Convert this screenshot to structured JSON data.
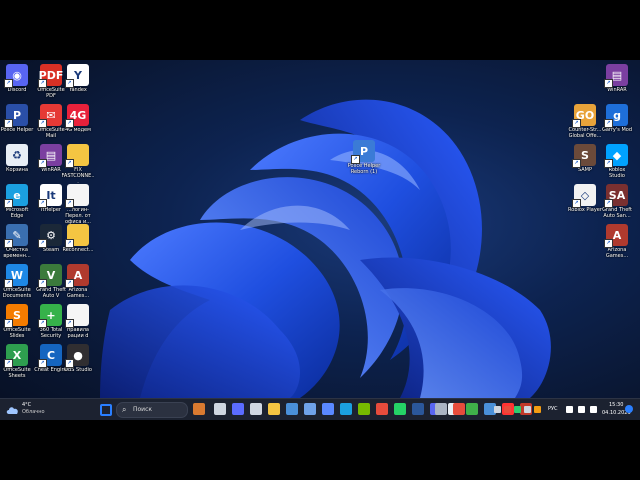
{
  "desktop": {
    "icons": [
      {
        "label": "Discord",
        "icon": "discord-icon",
        "color": "#5865f2",
        "glyph": "◉"
      },
      {
        "label": "OfficeSuite PDF",
        "icon": "pdf-icon",
        "color": "#d93025",
        "glyph": "PDF"
      },
      {
        "label": "Yandex",
        "icon": "yandex-icon",
        "color": "#ffffff",
        "glyph": "Y"
      },
      {
        "label": "Police Helper",
        "icon": "police-helper-icon",
        "color": "#2a4fa8",
        "glyph": "P"
      },
      {
        "label": "OfficeSuite Mail",
        "icon": "mail-icon",
        "color": "#e53935",
        "glyph": "✉"
      },
      {
        "label": "4G модем",
        "icon": "modem-icon",
        "color": "#e8213b",
        "glyph": "4G"
      },
      {
        "label": "Корзина",
        "icon": "recycle-bin-icon",
        "color": "#e8eef5",
        "glyph": "♻"
      },
      {
        "label": "WinRAR",
        "icon": "winrar-icon",
        "color": "#7b3fa0",
        "glyph": "▤"
      },
      {
        "label": "FIX FASTCONNE...",
        "icon": "folder-icon",
        "color": "#f4c542",
        "glyph": ""
      },
      {
        "label": "Microsoft Edge",
        "icon": "edge-icon",
        "color": "#1ba0e0",
        "glyph": "e"
      },
      {
        "label": "ItHelper",
        "icon": "ithelper-icon",
        "color": "#ffffff",
        "glyph": "It"
      },
      {
        "label": "...логин-Перел. от офиса и...",
        "icon": "document-icon",
        "color": "#f5f5f5",
        "glyph": ""
      },
      {
        "label": "Очистка временн...",
        "icon": "cleanup-icon",
        "color": "#3a6fb0",
        "glyph": "✎"
      },
      {
        "label": "Steam",
        "icon": "steam-icon",
        "color": "#1b2838",
        "glyph": "⚙"
      },
      {
        "label": "Reconnect...",
        "icon": "folder-icon",
        "color": "#f4c542",
        "glyph": ""
      },
      {
        "label": "OfficeSuite Documents",
        "icon": "documents-icon",
        "color": "#1e88e5",
        "glyph": "W"
      },
      {
        "label": "Grand Theft Auto V",
        "icon": "gta-icon",
        "color": "#3b7a3b",
        "glyph": "V"
      },
      {
        "label": "Arizona Games...",
        "icon": "arizona-icon",
        "color": "#b03a2e",
        "glyph": "A"
      },
      {
        "label": "OfficeSuite Slides",
        "icon": "slides-icon",
        "color": "#f57c00",
        "glyph": "S"
      },
      {
        "label": "360 Total Security",
        "icon": "security-icon",
        "color": "#36b24a",
        "glyph": "+"
      },
      {
        "label": "правила рации d",
        "icon": "document-icon",
        "color": "#f5f5f5",
        "glyph": ""
      },
      {
        "label": "OfficeSuite Sheets",
        "icon": "sheets-icon",
        "color": "#2e9e4f",
        "glyph": "X"
      },
      {
        "label": "Cheat Engine",
        "icon": "cheat-engine-icon",
        "color": "#1565c0",
        "glyph": "C"
      },
      {
        "label": "OBS Studio",
        "icon": "obs-icon",
        "color": "#302e31",
        "glyph": "●"
      },
      {
        "label": "Police Helper Reborn (1)",
        "icon": "police-helper-icon",
        "color": "#3b7bd6",
        "glyph": "P"
      },
      {
        "label": "WinRAR",
        "icon": "winrar-icon",
        "color": "#7b3fa0",
        "glyph": "▤"
      },
      {
        "label": "Counter-Str... Global Offe...",
        "icon": "csgo-icon",
        "color": "#e8a33a",
        "glyph": "GO"
      },
      {
        "label": "Garry's Mod",
        "icon": "gmod-icon",
        "color": "#1e6fd9",
        "glyph": "g"
      },
      {
        "label": "SAMP",
        "icon": "samp-icon",
        "color": "#6b4a3a",
        "glyph": "S"
      },
      {
        "label": "Roblox Studio",
        "icon": "roblox-studio-icon",
        "color": "#00a2ff",
        "glyph": "◆"
      },
      {
        "label": "Roblox Player",
        "icon": "roblox-icon",
        "color": "#f2f2f2",
        "glyph": "◇"
      },
      {
        "label": "Grand Theft Auto San...",
        "icon": "gta-sa-icon",
        "color": "#7a3030",
        "glyph": "SA"
      },
      {
        "label": "Arizona Games...",
        "icon": "arizona-icon",
        "color": "#b03a2e",
        "glyph": "A"
      }
    ]
  },
  "taskbar": {
    "weather": {
      "temp": "4°C",
      "desc": "Облачно"
    },
    "search_placeholder": "Поиск",
    "apps": [
      {
        "icon": "start-icon",
        "color": "#2a7fff"
      },
      {
        "icon": "game-app-icon",
        "color": "#d97a30"
      },
      {
        "icon": "task-view-icon",
        "color": "#cfd6e0"
      },
      {
        "icon": "chat-icon",
        "color": "#5b6cff"
      },
      {
        "icon": "app-icon",
        "color": "#d0d7e2"
      },
      {
        "icon": "file-explorer-icon",
        "color": "#f4c542"
      },
      {
        "icon": "app-icon",
        "color": "#4a90d9"
      },
      {
        "icon": "app-icon",
        "color": "#6fa2e8"
      },
      {
        "icon": "app-icon",
        "color": "#5a88ff"
      },
      {
        "icon": "edge-icon",
        "color": "#1ba0e0"
      },
      {
        "icon": "nvidia-icon",
        "color": "#76b900"
      },
      {
        "icon": "chrome-icon",
        "color": "#e74c3c"
      },
      {
        "icon": "whatsapp-icon",
        "color": "#25d366"
      },
      {
        "icon": "word-icon",
        "color": "#2b579a"
      },
      {
        "icon": "discord-icon",
        "color": "#5865f2"
      },
      {
        "icon": "document-icon",
        "color": "#e8eef5"
      },
      {
        "icon": "app-icon",
        "color": "#3fb04a"
      },
      {
        "icon": "app-icon",
        "color": "#4a90d9"
      },
      {
        "icon": "yandex-icon",
        "color": "#ff3333"
      },
      {
        "icon": "app-icon",
        "color": "#c0392b"
      },
      {
        "icon": "steam-icon",
        "color": "#aab4c4"
      },
      {
        "icon": "app-icon",
        "color": "#e74c3c"
      }
    ],
    "tray": {
      "language": "РУС",
      "time": "15:30",
      "date": "04.10.2023",
      "icons": [
        {
          "icon": "chevron-up-icon",
          "color": "#cfd6e0"
        },
        {
          "icon": "tray-app-icon",
          "color": "#e74c3c"
        },
        {
          "icon": "tray-app-icon",
          "color": "#2ecc71"
        },
        {
          "icon": "tray-app-icon",
          "color": "#d0d7e2"
        },
        {
          "icon": "tray-app-icon",
          "color": "#f39c12"
        },
        {
          "icon": "tray-app-icon",
          "color": "#3498db"
        },
        {
          "icon": "tray-app-icon",
          "color": "#9b59b6"
        },
        {
          "icon": "tray-app-icon",
          "color": "#e74c3c"
        },
        {
          "icon": "tray-app-icon",
          "color": "#1abc9c"
        },
        {
          "icon": "tray-app-icon",
          "color": "#d0d7e2"
        },
        {
          "icon": "wifi-icon",
          "color": "#ffffff"
        },
        {
          "icon": "speaker-icon",
          "color": "#ffffff"
        },
        {
          "icon": "battery-icon",
          "color": "#ffffff"
        }
      ],
      "notification": {
        "icon": "notification-icon",
        "color": "#2a7fff"
      }
    }
  }
}
